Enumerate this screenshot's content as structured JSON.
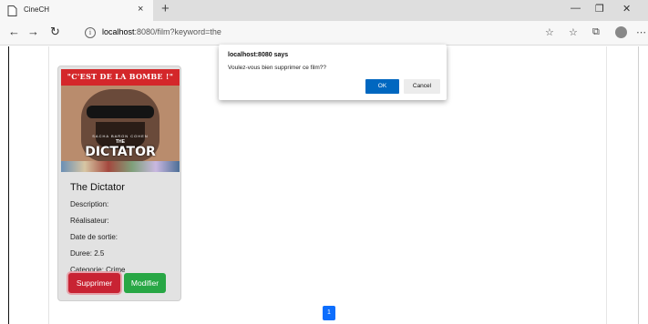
{
  "browser": {
    "tab_title": "CineCH",
    "tab_close": "×",
    "new_tab": "+",
    "url_host": "localhost",
    "url_rest": ":8080/film?keyword=the",
    "icons": [
      "page-icon",
      "back-icon",
      "forward-icon",
      "refresh-icon",
      "info-icon",
      "favorite-star-icon",
      "favorites-list-icon",
      "collections-icon",
      "profile-icon",
      "more-icon"
    ]
  },
  "film": {
    "poster": {
      "quote": "\"C'EST DE LA BOMBE !\"",
      "actor": "SACHA BARON COHEN",
      "the": "THE",
      "title": "DICTATOR"
    },
    "title": "The Dictator",
    "description_label": "Description:",
    "director_label": "Réalisateur:",
    "release_label": "Date de sortie:",
    "duration_label": "Duree: 2.5",
    "category_label": "Categorie: Crime",
    "delete_button": "Supprimer",
    "edit_button": "Modifier"
  },
  "pagination": {
    "current_page": "1"
  },
  "dialog": {
    "title": "localhost:8080 says",
    "message": "Voulez-vous bien supprimer ce film??",
    "ok_label": "OK",
    "cancel_label": "Cancel"
  },
  "colors": {
    "delete": "#c82333",
    "edit": "#28a745",
    "primary": "#0d6efd",
    "dialog_ok": "#0067c0"
  }
}
